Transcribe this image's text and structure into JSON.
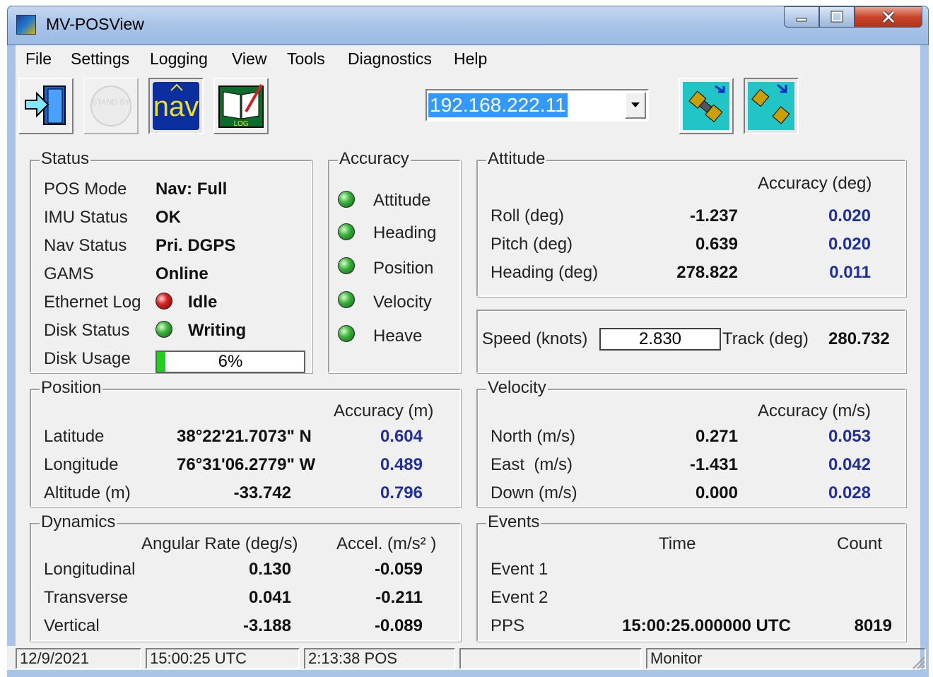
{
  "window": {
    "title": "MV-POSView",
    "controls": {
      "minimize": "‒",
      "maximize": "□",
      "close": "✕"
    }
  },
  "menu": [
    "File",
    "Settings",
    "Logging",
    "View",
    "Tools",
    "Diagnostics",
    "Help"
  ],
  "toolbar": {
    "buttons": [
      {
        "icon": "exit-icon",
        "label": ""
      },
      {
        "icon": "standby-icon",
        "label": "STAND BY"
      },
      {
        "icon": "nav-icon",
        "label": "nav"
      },
      {
        "icon": "log-icon",
        "label": "LOG"
      }
    ],
    "ip_address": "192.168.222.11",
    "connect_icons": [
      "connect-icon",
      "disconnect-icon"
    ]
  },
  "status": {
    "title": "Status",
    "rows": [
      {
        "label": "POS Mode",
        "value": "Nav: Full"
      },
      {
        "label": "IMU Status",
        "value": "OK"
      },
      {
        "label": "Nav Status",
        "value": "Pri. DGPS"
      },
      {
        "label": "GAMS",
        "value": "Online"
      },
      {
        "label": "Ethernet Log",
        "value": "Idle",
        "led": "red"
      },
      {
        "label": "Disk Status",
        "value": "Writing",
        "led": "green"
      }
    ],
    "disk_usage": {
      "label": "Disk Usage",
      "text": "6%",
      "fraction": 0.06
    }
  },
  "accuracy": {
    "title": "Accuracy",
    "items": [
      "Attitude",
      "Heading",
      "Position",
      "Velocity",
      "Heave"
    ]
  },
  "attitude": {
    "title": "Attitude",
    "accuracy_header": "Accuracy (deg)",
    "rows": [
      {
        "label": "Roll (deg)",
        "value": "-1.237",
        "accuracy": "0.020"
      },
      {
        "label": "Pitch (deg)",
        "value": "0.639",
        "accuracy": "0.020"
      },
      {
        "label": "Heading (deg)",
        "value": "278.822",
        "accuracy": "0.011"
      }
    ]
  },
  "speed": {
    "label": "Speed (knots)",
    "value": "2.830",
    "track_label": "Track (deg)",
    "track_value": "280.732"
  },
  "position": {
    "title": "Position",
    "accuracy_header": "Accuracy (m)",
    "rows": [
      {
        "label": "Latitude",
        "value": "38°22'21.7073\" N",
        "accuracy": "0.604"
      },
      {
        "label": "Longitude",
        "value": "76°31'06.2779\" W",
        "accuracy": "0.489"
      },
      {
        "label": "Altitude (m)",
        "value": "-33.742",
        "accuracy": "0.796"
      }
    ]
  },
  "velocity": {
    "title": "Velocity",
    "accuracy_header": "Accuracy (m/s)",
    "rows": [
      {
        "label": "North (m/s)",
        "value": "0.271",
        "accuracy": "0.053"
      },
      {
        "label": "East  (m/s)",
        "value": "-1.431",
        "accuracy": "0.042"
      },
      {
        "label": "Down (m/s)",
        "value": "0.000",
        "accuracy": "0.028"
      }
    ]
  },
  "dynamics": {
    "title": "Dynamics",
    "headers": [
      "Angular Rate (deg/s)",
      "Accel. (m/s² )"
    ],
    "rows": [
      {
        "label": "Longitudinal",
        "rate": "0.130",
        "accel": "-0.059"
      },
      {
        "label": "Transverse",
        "rate": "0.041",
        "accel": "-0.211"
      },
      {
        "label": "Vertical",
        "rate": "-3.188",
        "accel": "-0.089"
      }
    ]
  },
  "events": {
    "title": "Events",
    "headers": [
      "Time",
      "Count"
    ],
    "rows": [
      {
        "label": "Event 1",
        "time": "",
        "count": ""
      },
      {
        "label": "Event 2",
        "time": "",
        "count": ""
      },
      {
        "label": "PPS",
        "time": "15:00:25.000000 UTC",
        "count": "8019"
      }
    ]
  },
  "statusbar": [
    "12/9/2021",
    "15:00:25 UTC",
    "2:13:38 POS",
    "",
    "Monitor"
  ]
}
